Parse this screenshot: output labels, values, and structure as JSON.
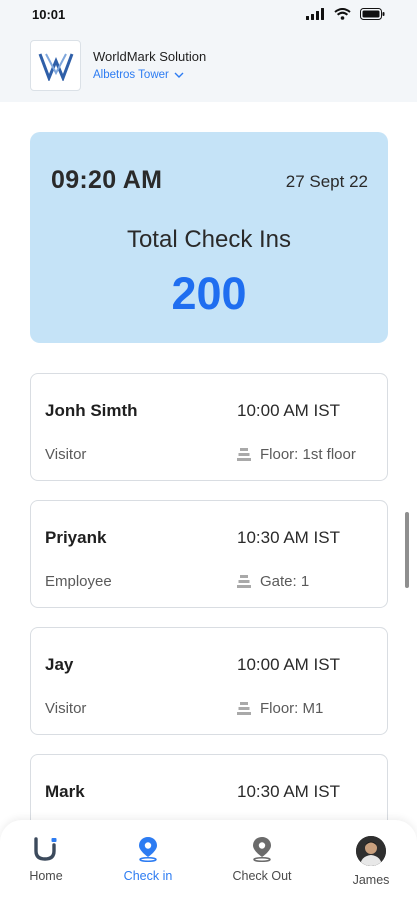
{
  "status": {
    "time": "10:01"
  },
  "header": {
    "org_name": "WorldMark Solution",
    "building": "Albetros Tower"
  },
  "summary": {
    "time": "09:20 AM",
    "date": "27 Sept 22",
    "label": "Total Check Ins",
    "count": "200"
  },
  "checkins": [
    {
      "name": "Jonh Simth",
      "time": "10:00 AM IST",
      "role": "Visitor",
      "location": "Floor: 1st floor"
    },
    {
      "name": "Priyank",
      "time": "10:30 AM IST",
      "role": "Employee",
      "location": "Gate: 1"
    },
    {
      "name": "Jay",
      "time": "10:00 AM IST",
      "role": "Visitor",
      "location": "Floor: M1"
    },
    {
      "name": "Mark",
      "time": "10:30 AM IST",
      "role": "",
      "location": ""
    }
  ],
  "nav": {
    "home": "Home",
    "checkin": "Check in",
    "checkout": "Check Out",
    "profile": "James"
  },
  "colors": {
    "accent": "#2d7cf2",
    "count": "#1f6ef0",
    "summary_bg": "#c5e3f7"
  }
}
